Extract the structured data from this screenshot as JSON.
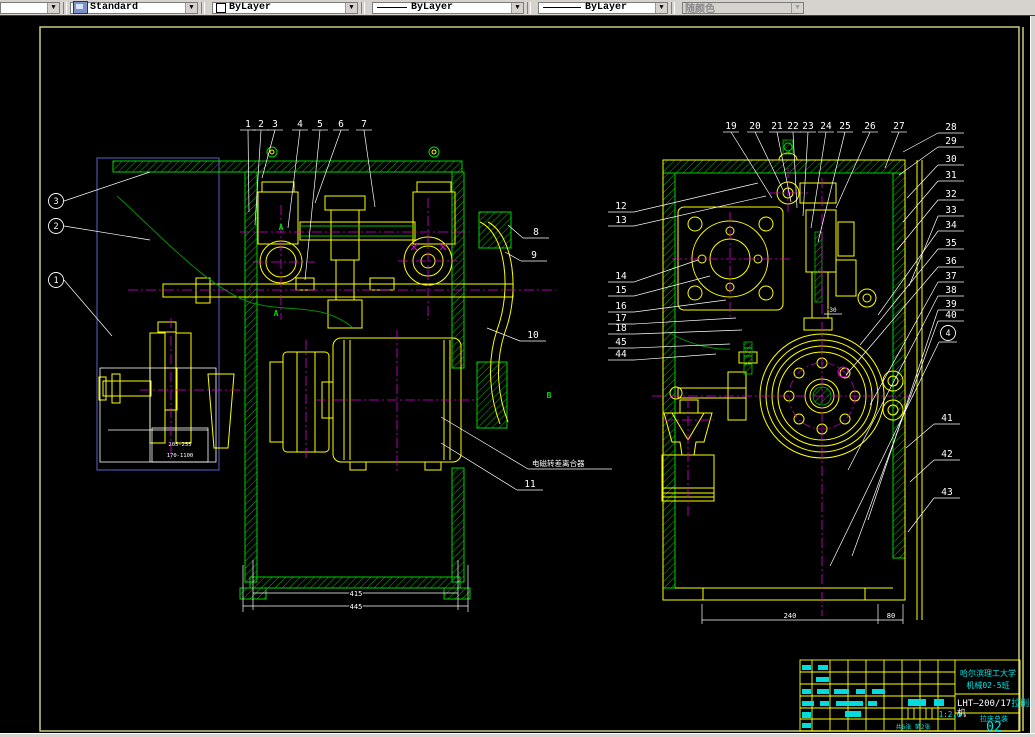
{
  "toolbar": {
    "style_combo": {
      "value": "Standard"
    },
    "color_combo": {
      "value": "ByLayer"
    },
    "linetype_combo": {
      "value": "ByLayer"
    },
    "lineweight_combo": {
      "value": "ByLayer"
    },
    "plotstyle_combo": {
      "value": "随颜色"
    }
  },
  "drawing": {
    "left_view": {
      "top_callouts": [
        "1",
        "2",
        "3",
        "4",
        "5",
        "6",
        "7"
      ],
      "left_circled_callouts": [
        "3",
        "2",
        "1"
      ],
      "right_callouts": [
        "8",
        "9",
        "10",
        "11"
      ],
      "part_label": "电磁转差离合器",
      "section_letters": [
        "A",
        "A",
        "B"
      ],
      "dims": {
        "inner": "415",
        "outer": "445",
        "box_top": "205-255",
        "box_bottom": "170-1100"
      }
    },
    "right_view": {
      "top_callouts": [
        "19",
        "20",
        "21",
        "22",
        "23",
        "24",
        "25",
        "26",
        "27"
      ],
      "right_callouts": [
        "28",
        "29",
        "30",
        "31",
        "32",
        "33",
        "34",
        "35",
        "36",
        "37",
        "38",
        "39",
        "40"
      ],
      "right_circled_callout": "4",
      "lower_right_callouts": [
        "41",
        "42",
        "43"
      ],
      "left_callouts": [
        "12",
        "13",
        "14",
        "15",
        "16",
        "17",
        "18",
        "45",
        "44"
      ],
      "dims": {
        "width": "240",
        "side": "80",
        "small": "30"
      }
    }
  },
  "title_block": {
    "school": "哈尔滨理工大学",
    "class_name": "机械02-5班",
    "product_model": "LHT—200/17",
    "product_suffix": "拉削",
    "product_line2": "机",
    "drawing_label": "拉床总装",
    "drawing_number": "02",
    "scale": "1:2.6",
    "sheet_info": "共6张 第2张"
  }
}
